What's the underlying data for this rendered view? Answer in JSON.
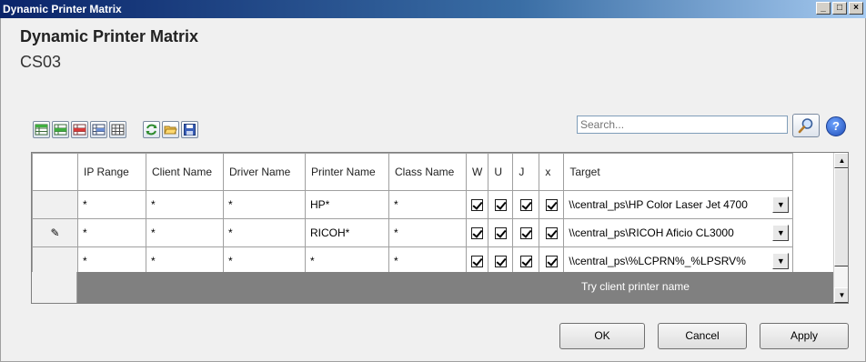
{
  "window": {
    "title": "Dynamic Printer Matrix"
  },
  "header": {
    "title": "Dynamic Printer Matrix",
    "subtitle": "CS03"
  },
  "toolbar": {
    "buttons": [
      "insert-row-above",
      "insert-row-below",
      "delete-row",
      "move-row",
      "edit-table",
      "refresh",
      "open",
      "save"
    ]
  },
  "search": {
    "placeholder": "Search..."
  },
  "help_label": "?",
  "grid": {
    "columns": [
      "IP Range",
      "Client Name",
      "Driver Name",
      "Printer Name",
      "Class Name",
      "W",
      "U",
      "J",
      "x",
      "Target"
    ],
    "rows": [
      {
        "ip": "*",
        "client": "*",
        "driver": "*",
        "printer": "HP*",
        "class": "*",
        "w": true,
        "u": true,
        "j": true,
        "x": true,
        "target": "\\\\central_ps\\HP Color Laser Jet 4700",
        "editing": false
      },
      {
        "ip": "*",
        "client": "*",
        "driver": "*",
        "printer": "RICOH*",
        "class": "*",
        "w": true,
        "u": true,
        "j": true,
        "x": true,
        "target": "\\\\central_ps\\RICOH Aficio CL3000",
        "editing": true
      },
      {
        "ip": "*",
        "client": "*",
        "driver": "*",
        "printer": "*",
        "class": "*",
        "w": true,
        "u": true,
        "j": true,
        "x": true,
        "target": "\\\\central_ps\\%LCPRN%_%LPSRV%",
        "editing": false
      }
    ],
    "footer_text": "Try client printer name"
  },
  "buttons": {
    "ok": "OK",
    "cancel": "Cancel",
    "apply": "Apply"
  },
  "colors": {
    "titlebar": "#0a246a",
    "footer_row": "#808080"
  }
}
